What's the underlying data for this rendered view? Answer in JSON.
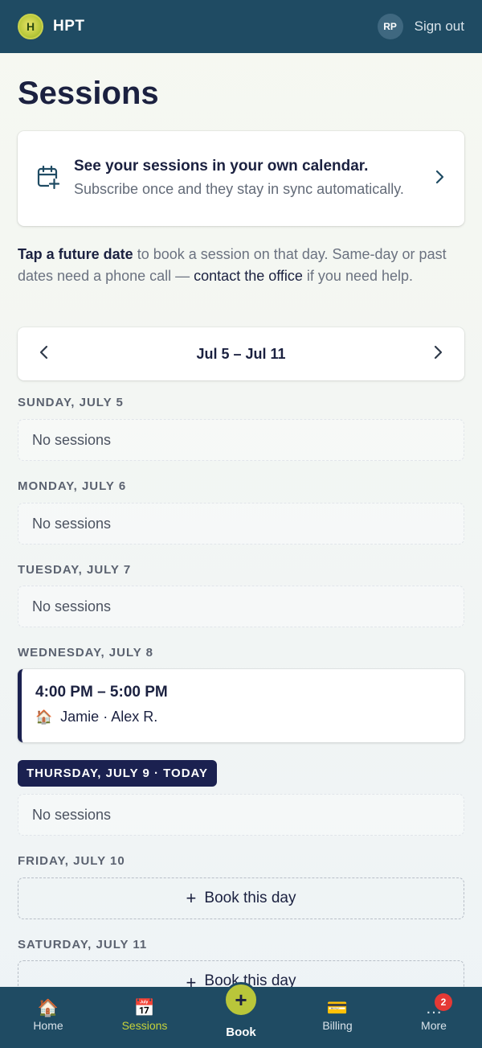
{
  "header": {
    "logo_letter": "H",
    "brand": "HPT",
    "avatar_initials": "RP",
    "sign_out": "Sign out"
  },
  "page": {
    "title": "Sessions"
  },
  "calendar_card": {
    "title": "See your sessions in your own calendar.",
    "description": "Subscribe once and they stay in sync automatically.",
    "icon": "calendar-plus-icon"
  },
  "intro": {
    "bold": "Tap a future date",
    "text1": " to book a session on that day. Same-day or past dates need a phone call — ",
    "link": "contact the office",
    "text2": " if you need help."
  },
  "week": {
    "label": "Jul 5 – Jul 11",
    "prev": "‹",
    "next": "›"
  },
  "days": {
    "sun": {
      "label": "SUNDAY, JULY 5",
      "empty": "No sessions"
    },
    "mon": {
      "label": "MONDAY, JULY 6",
      "empty": "No sessions"
    },
    "tue": {
      "label": "TUESDAY, JULY 7",
      "empty": "No sessions"
    },
    "wed": {
      "label": "WEDNESDAY, JULY 8",
      "session": {
        "time": "4:00 PM – 5:00 PM",
        "icon": "🏠",
        "who": "Jamie · Alex R."
      }
    },
    "thu": {
      "label": "THURSDAY, JULY 9 · TODAY",
      "empty": "No sessions"
    },
    "fri": {
      "label": "FRIDAY, JULY 10",
      "book": "Book this day"
    },
    "sat": {
      "label": "SATURDAY, JULY 11",
      "book": "Book this day"
    }
  },
  "bottom_nav": {
    "home": {
      "label": "Home",
      "icon": "🏠"
    },
    "sessions": {
      "label": "Sessions",
      "icon": "📅"
    },
    "book": {
      "label": "Book",
      "icon": "+"
    },
    "billing": {
      "label": "Billing",
      "icon": "💳"
    },
    "more": {
      "label": "More",
      "icon": "…",
      "badge": "2"
    }
  },
  "colors": {
    "header_bg": "#1f4b63",
    "accent": "#b9c63a",
    "today_pill": "#1b2150",
    "badge": "#e53935"
  }
}
